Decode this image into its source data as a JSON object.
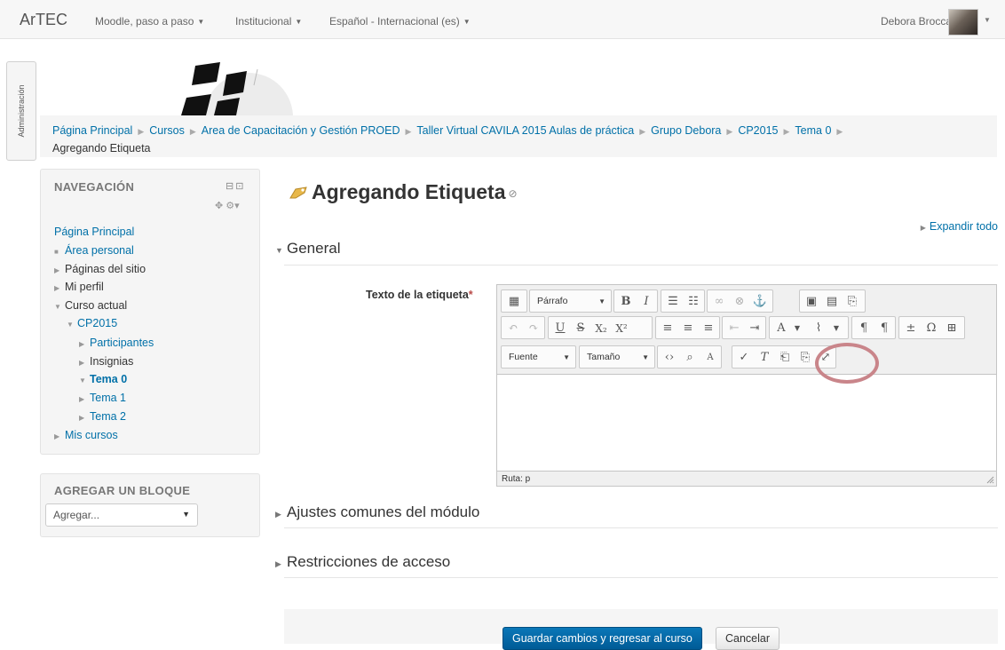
{
  "navbar": {
    "brand": "ArTEC",
    "menus": [
      "Moodle, paso a paso",
      "Institucional",
      "Español - Internacional (es)"
    ],
    "user": "Debora Brocca"
  },
  "admin_tab": "Administración",
  "breadcrumb": {
    "items": [
      "Página Principal",
      "Cursos",
      "Area de Capacitación y Gestión PROED",
      "Taller Virtual CAVILA 2015 Aulas de práctica",
      "Grupo Debora",
      "CP2015",
      "Tema 0"
    ],
    "current": "Agregando Etiqueta"
  },
  "navigation": {
    "title": "NAVEGACIÓN",
    "items": [
      {
        "label": "Página Principal"
      },
      {
        "label": "Área personal"
      },
      {
        "label": "Páginas del sitio"
      },
      {
        "label": "Mi perfil"
      },
      {
        "label": "Curso actual"
      },
      {
        "label": "CP2015"
      },
      {
        "label": "Participantes"
      },
      {
        "label": "Insignias"
      },
      {
        "label": "Tema 0"
      },
      {
        "label": "Tema 1"
      },
      {
        "label": "Tema 2"
      },
      {
        "label": "Mis cursos"
      }
    ]
  },
  "add_block": {
    "title": "AGREGAR UN BLOQUE",
    "selected": "Agregar..."
  },
  "page": {
    "title": "Agregando Etiqueta",
    "expand_all": "Expandir todo"
  },
  "sections": {
    "general": "General",
    "common": "Ajustes comunes del módulo",
    "restrictions": "Restricciones de acceso"
  },
  "form": {
    "label": "Texto de la etiqueta",
    "required_mark": "*",
    "editor": {
      "format_select": "Párrafo",
      "font_select": "Fuente",
      "size_select": "Tamaño",
      "path": "Ruta: p"
    }
  },
  "buttons": {
    "save": "Guardar cambios y regresar al curso",
    "cancel": "Cancelar"
  },
  "colors": {
    "link": "#0070a8",
    "primary_button": "#005b96",
    "highlight": "#c9858a"
  }
}
